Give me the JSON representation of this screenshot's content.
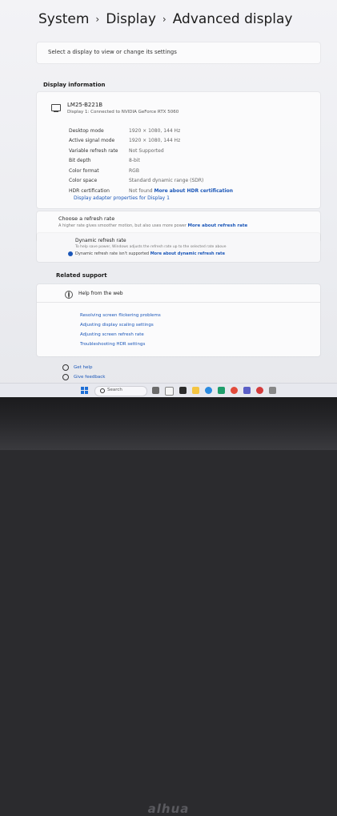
{
  "breadcrumb": {
    "root": "System",
    "mid": "Display",
    "current": "Advanced display"
  },
  "select_display": {
    "label": "Select a display to view or change its settings"
  },
  "display_info": {
    "section_title": "Display information",
    "monitor_name": "LM25-B221B",
    "monitor_sub": "Display 1: Connected to NVIDIA GeForce RTX 5060",
    "rows": [
      {
        "key": "Desktop mode",
        "value": "1920 × 1080, 144 Hz"
      },
      {
        "key": "Active signal mode",
        "value": "1920 × 1080, 144 Hz"
      },
      {
        "key": "Variable refresh rate",
        "value": "Not Supported"
      },
      {
        "key": "Bit depth",
        "value": "8-bit"
      },
      {
        "key": "Color format",
        "value": "RGB"
      },
      {
        "key": "Color space",
        "value": "Standard dynamic range (SDR)"
      },
      {
        "key": "HDR certification",
        "value": "Not found",
        "link": "More about HDR certification"
      }
    ],
    "adapter_link": "Display adapter properties for Display 1"
  },
  "refresh": {
    "title": "Choose a refresh rate",
    "desc": "A higher rate gives smoother motion, but also uses more power",
    "link": "More about refresh rate"
  },
  "dynamic": {
    "title": "Dynamic refresh rate",
    "desc": "To help save power, Windows adjusts the refresh rate up to the selected rate above",
    "note": "Dynamic refresh rate isn't supported",
    "link": "More about dynamic refresh rate"
  },
  "related": {
    "section_title": "Related support",
    "help_title": "Help from the web",
    "links": [
      "Resolving screen flickering problems",
      "Adjusting display scaling settings",
      "Adjusting screen refresh rate",
      "Troubleshooting HDR settings"
    ]
  },
  "footer": {
    "get_help": "Get help",
    "feedback": "Give feedback"
  },
  "taskbar": {
    "search_placeholder": "Search"
  },
  "bezel": {
    "brand": "alhua"
  },
  "colors": {
    "accent": "#1a56b8",
    "background": "#f3f3f6"
  }
}
